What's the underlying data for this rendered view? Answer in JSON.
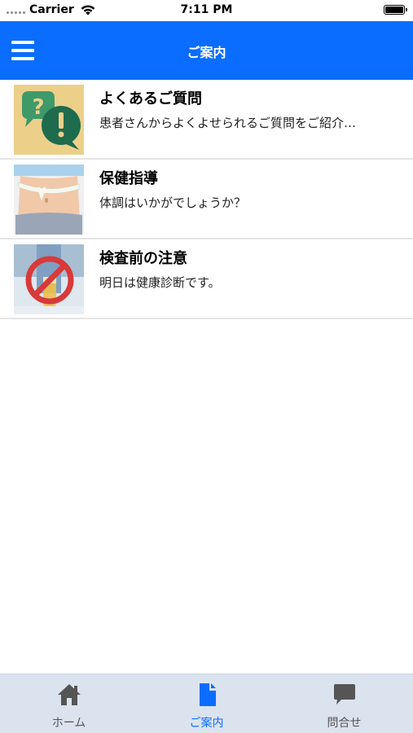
{
  "status_bar": {
    "carrier": "Carrier",
    "time": "7:11 PM"
  },
  "header": {
    "title": "ご案内",
    "menu_icon": "hamburger-menu-icon"
  },
  "list": {
    "items": [
      {
        "title": "よくあるご質問",
        "subtitle": "患者さんからよくよせられるご質問をご紹介…",
        "thumbnail": "question-exclamation-bubbles"
      },
      {
        "title": "保健指導",
        "subtitle": "体調はいかがでしょうか？",
        "thumbnail": "waist-measuring-tape"
      },
      {
        "title": "検査前の注意",
        "subtitle": "明日は健康診断です。",
        "thumbnail": "no-drinking-sign"
      }
    ]
  },
  "tab_bar": {
    "active_color": "#0a6dff",
    "tabs": [
      {
        "label": "ホーム",
        "icon": "home-icon",
        "active": false
      },
      {
        "label": "ご案内",
        "icon": "document-icon",
        "active": true
      },
      {
        "label": "問合せ",
        "icon": "chat-bubble-icon",
        "active": false
      }
    ]
  },
  "colors": {
    "nav_background": "#0a6dff",
    "tab_bar_background": "#dbe3ef",
    "divider": "#e5e5e5"
  }
}
